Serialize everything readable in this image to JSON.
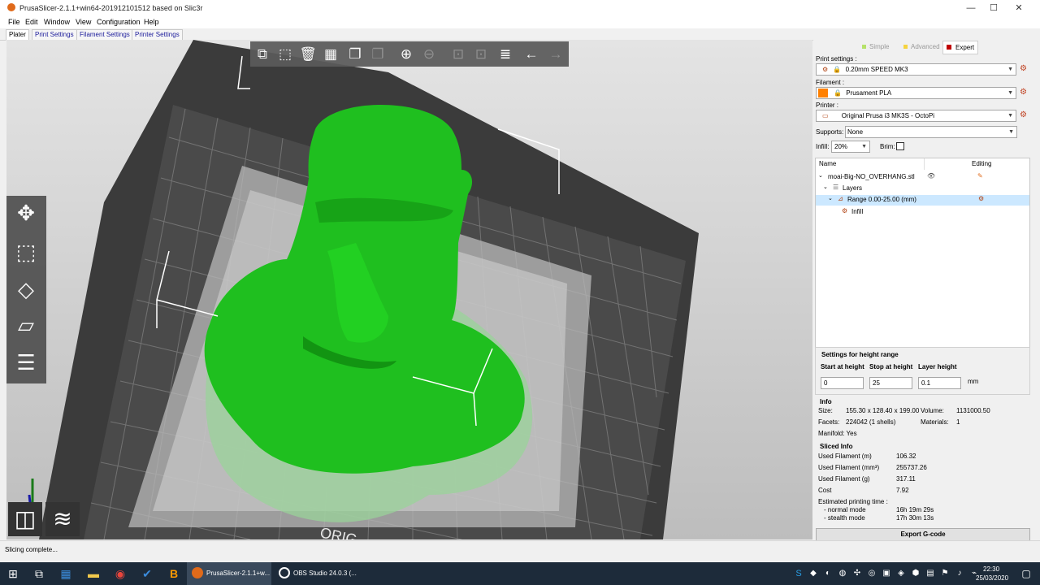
{
  "window": {
    "title": "PrusaSlicer-2.1.1+win64-201912101512 based on Slic3r",
    "controls": [
      "—",
      "☐",
      "✕"
    ]
  },
  "menu": [
    "File",
    "Edit",
    "Window",
    "View",
    "Configuration",
    "Help"
  ],
  "tabs": [
    "Plater",
    "Print Settings",
    "Filament Settings",
    "Printer Settings"
  ],
  "viewport": {
    "bed_label": "ORIG"
  },
  "modes": [
    "Simple",
    "Advanced",
    "Expert"
  ],
  "print_settings": {
    "label": "Print settings :",
    "value": "0.20mm SPEED MK3"
  },
  "filament": {
    "label": "Filament :",
    "value": "Prusament PLA",
    "color": "#ff8000"
  },
  "printer": {
    "label": "Printer :",
    "value": "Original Prusa i3 MK3S - OctoPi"
  },
  "supports": {
    "label": "Supports:",
    "value": "None"
  },
  "infill": {
    "label": "Infill:",
    "value": "20%"
  },
  "brim": {
    "label": "Brim:"
  },
  "tree": {
    "col_name": "Name",
    "col_editing": "Editing",
    "object": "moai-Big-NO_OVERHANG.stl",
    "layers": "Layers",
    "range": "Range 0.00-25.00 (mm)",
    "infill": "Infill"
  },
  "height_range": {
    "title": "Settings for height range",
    "start_label": "Start at height",
    "stop_label": "Stop at height",
    "layer_label": "Layer height",
    "start": "0",
    "stop": "25",
    "layer": "0.1",
    "unit": "mm"
  },
  "info": {
    "title": "Info",
    "size_label": "Size:",
    "size": "155.30 x 128.40 x 199.00",
    "volume_label": "Volume:",
    "volume": "1131000.50",
    "facets_label": "Facets:",
    "facets": "224042 (1 shells)",
    "materials_label": "Materials:",
    "materials": "1",
    "manifold": "Manifold: Yes"
  },
  "sliced": {
    "title": "Sliced Info",
    "rows": [
      {
        "k": "Used Filament (m)",
        "v": "106.32"
      },
      {
        "k": "Used Filament (mm³)",
        "v": "255737.26"
      },
      {
        "k": "Used Filament (g)",
        "v": "317.11"
      },
      {
        "k": "Cost",
        "v": "7.92"
      }
    ],
    "time_label": "Estimated printing time :",
    "normal_label": "- normal mode",
    "normal": "16h 19m 29s",
    "stealth_label": "- stealth mode",
    "stealth": "17h 30m 13s"
  },
  "export_button": "Export G-code",
  "status": "Slicing complete...",
  "taskbar": {
    "app1": "PrusaSlicer-2.1.1+w...",
    "app2": "OBS Studio 24.0.3 (...",
    "time": "22:30",
    "date": "25/03/2020"
  },
  "colors": {
    "model_green": "#1fbf1f",
    "accent_orange": "#e06a1a",
    "expert_red": "#c00000"
  }
}
